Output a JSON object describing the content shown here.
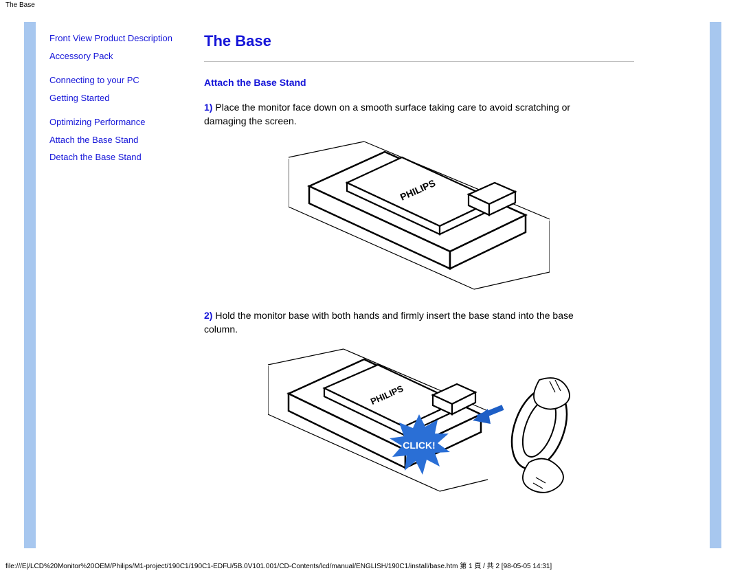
{
  "header": {
    "title": "The Base"
  },
  "sidebar": {
    "links": [
      "Front View Product Description",
      "Accessory Pack",
      "Connecting to your PC",
      "Getting Started",
      "Optimizing Performance",
      "Attach the Base Stand",
      "Detach the Base Stand"
    ]
  },
  "content": {
    "heading": "The Base",
    "section_title": "Attach the Base Stand",
    "step1_num": "1)",
    "step1_text": " Place the monitor face down on a smooth surface taking care to avoid scratching or damaging the screen.",
    "step2_num": "2)",
    "step2_text": " Hold the monitor base with both hands and firmly insert the base stand into the base column.",
    "click_label": "CLICK!",
    "brand": "PHILIPS"
  },
  "footer": {
    "path": "file:///E|/LCD%20Monitor%20OEM/Philips/M1-project/190C1/190C1-EDFU/5B.0V101.001/CD-Contents/lcd/manual/ENGLISH/190C1/install/base.htm 第 1 頁 / 共 2 [98-05-05 14:31]"
  }
}
